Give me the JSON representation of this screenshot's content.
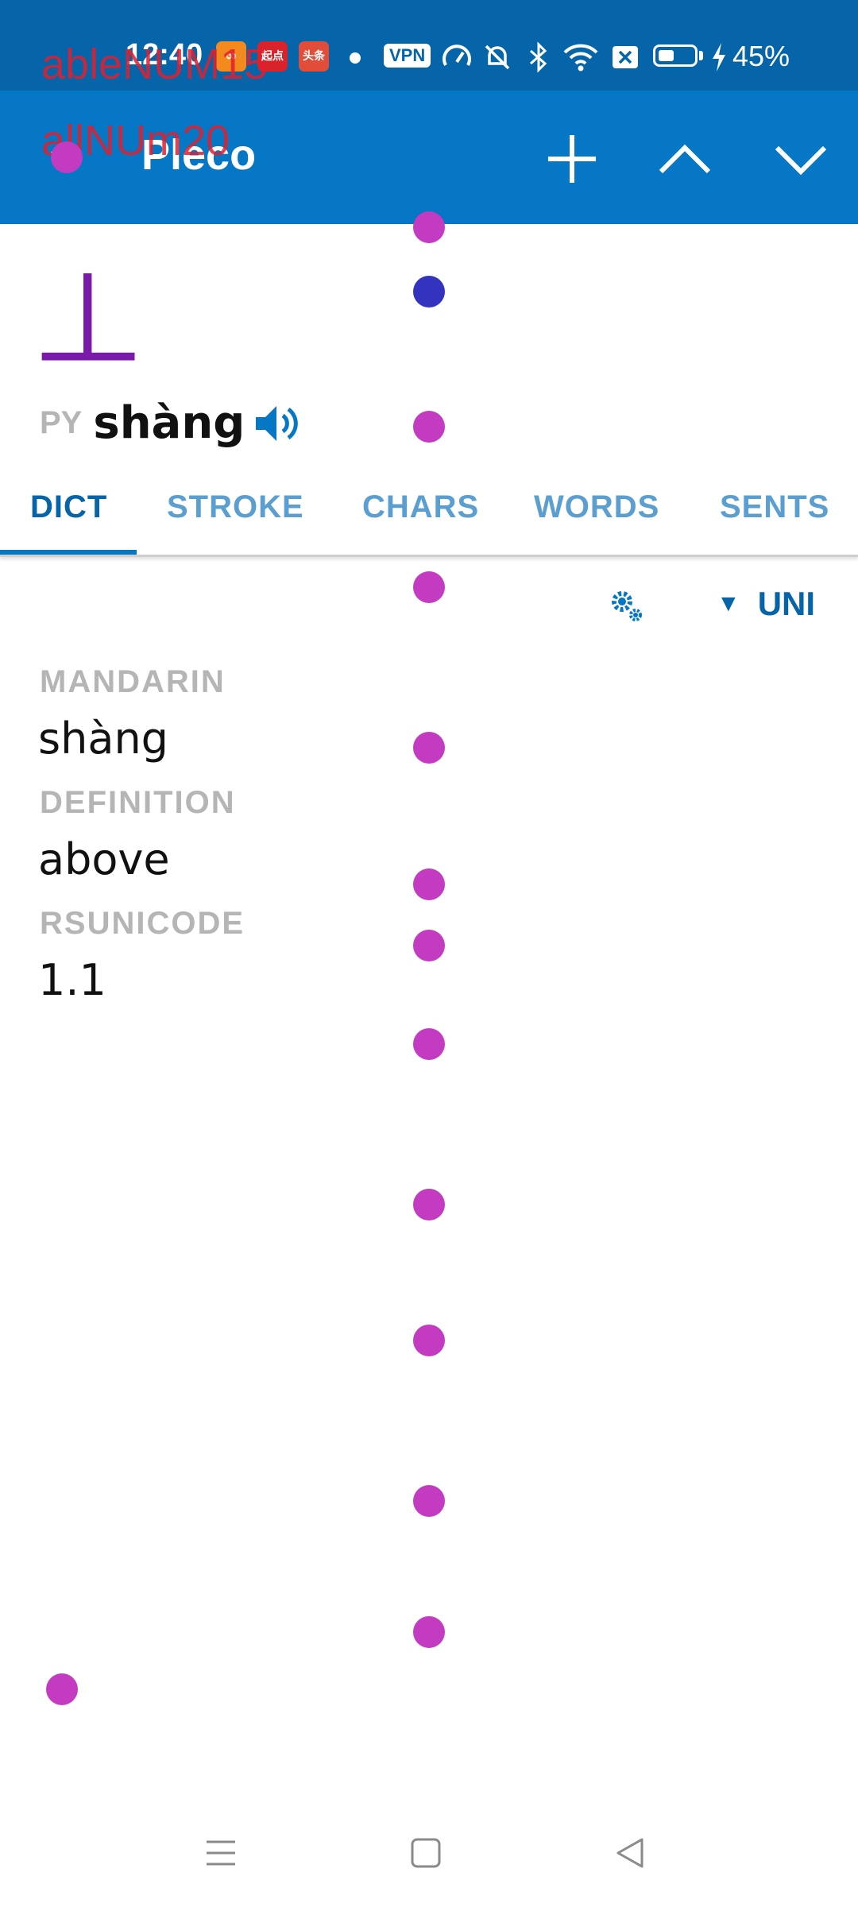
{
  "status_bar": {
    "time": "12:40",
    "apps": [
      {
        "icon": "social-app-icon",
        "label": "∞",
        "color": "#f28a1e"
      },
      {
        "icon": "news-app-icon",
        "label": "起点",
        "color": "#d8232a"
      },
      {
        "icon": "reader-app-icon",
        "label": "头条",
        "color": "#e24d3a"
      }
    ],
    "vpn_label": "VPN",
    "battery_level": 0.45,
    "battery_percent": "45%"
  },
  "overlay": {
    "line1": "ableNUM15",
    "line2": "allNUm20"
  },
  "app_bar": {
    "title": "Pleco"
  },
  "entry": {
    "headword": "丄",
    "py_label": "PY",
    "pinyin": "shàng"
  },
  "tabs": [
    {
      "label": "DICT",
      "active": true
    },
    {
      "label": "STROKE",
      "active": false
    },
    {
      "label": "CHARS",
      "active": false
    },
    {
      "label": "WORDS",
      "active": false
    },
    {
      "label": "SENTS",
      "active": false
    }
  ],
  "tools": {
    "dict_source": "UNI"
  },
  "fields": [
    {
      "label": "MANDARIN",
      "value": "shàng"
    },
    {
      "label": "DEFINITION",
      "value": "above"
    },
    {
      "label": "RSUNICODE",
      "value": "1.1"
    }
  ],
  "colors": {
    "status_bg": "#0565a8",
    "appbar_bg": "#0577c4",
    "headword": "#7a1aa8",
    "tab_inactive": "#5b9fd0",
    "tab_active": "#0565a8"
  }
}
